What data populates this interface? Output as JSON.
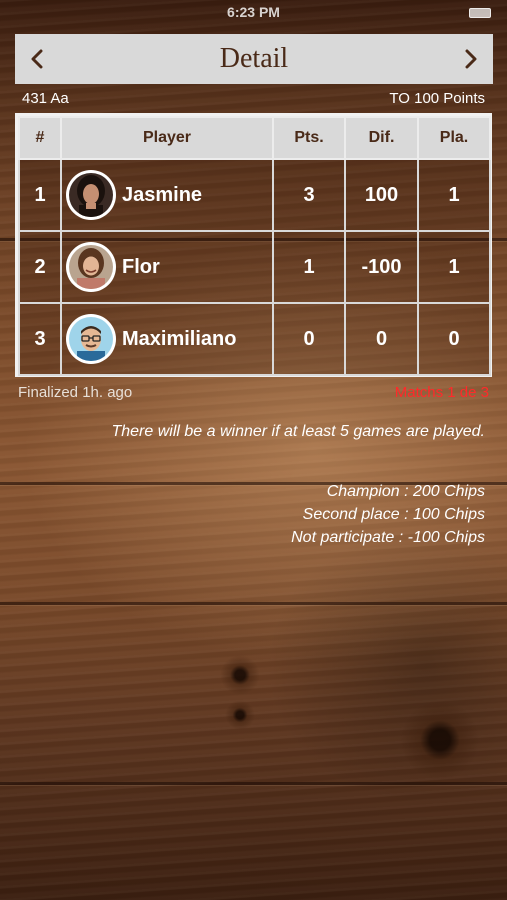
{
  "status_bar": {
    "time": "6:23 PM"
  },
  "header": {
    "title": "Detail",
    "prev_icon": "chevron-left-icon",
    "next_icon": "chevron-right-icon"
  },
  "subheader": {
    "left": "431 Aa",
    "right": "TO 100 Points"
  },
  "table": {
    "columns": [
      "#",
      "Player",
      "Pts.",
      "Dif.",
      "Pla."
    ],
    "rows": [
      {
        "rank": "1",
        "name": "Jasmine",
        "avatar": "photo-avatar-woman-dark-hair",
        "pts": "3",
        "dif": "100",
        "pla": "1"
      },
      {
        "rank": "2",
        "name": "Flor",
        "avatar": "photo-avatar-woman-smiling",
        "pts": "1",
        "dif": "-100",
        "pla": "1"
      },
      {
        "rank": "3",
        "name": "Maximiliano",
        "avatar": "cartoon-avatar-man-glasses",
        "pts": "0",
        "dif": "0",
        "pla": "0"
      }
    ]
  },
  "footer": {
    "left": "Finalized 1h. ago",
    "right": "Matchs 1 de 3",
    "right_color": "#ff2a2a"
  },
  "info": {
    "winner_note": "There will be a winner if at least 5 games are played.",
    "prizes": [
      "Champion : 200 Chips",
      "Second place : 100 Chips",
      "Not participate : -100 Chips"
    ]
  },
  "colors": {
    "header_bg": "#d9d9d9",
    "header_text": "#4a2a18",
    "wood_mid": "#8a5632"
  }
}
